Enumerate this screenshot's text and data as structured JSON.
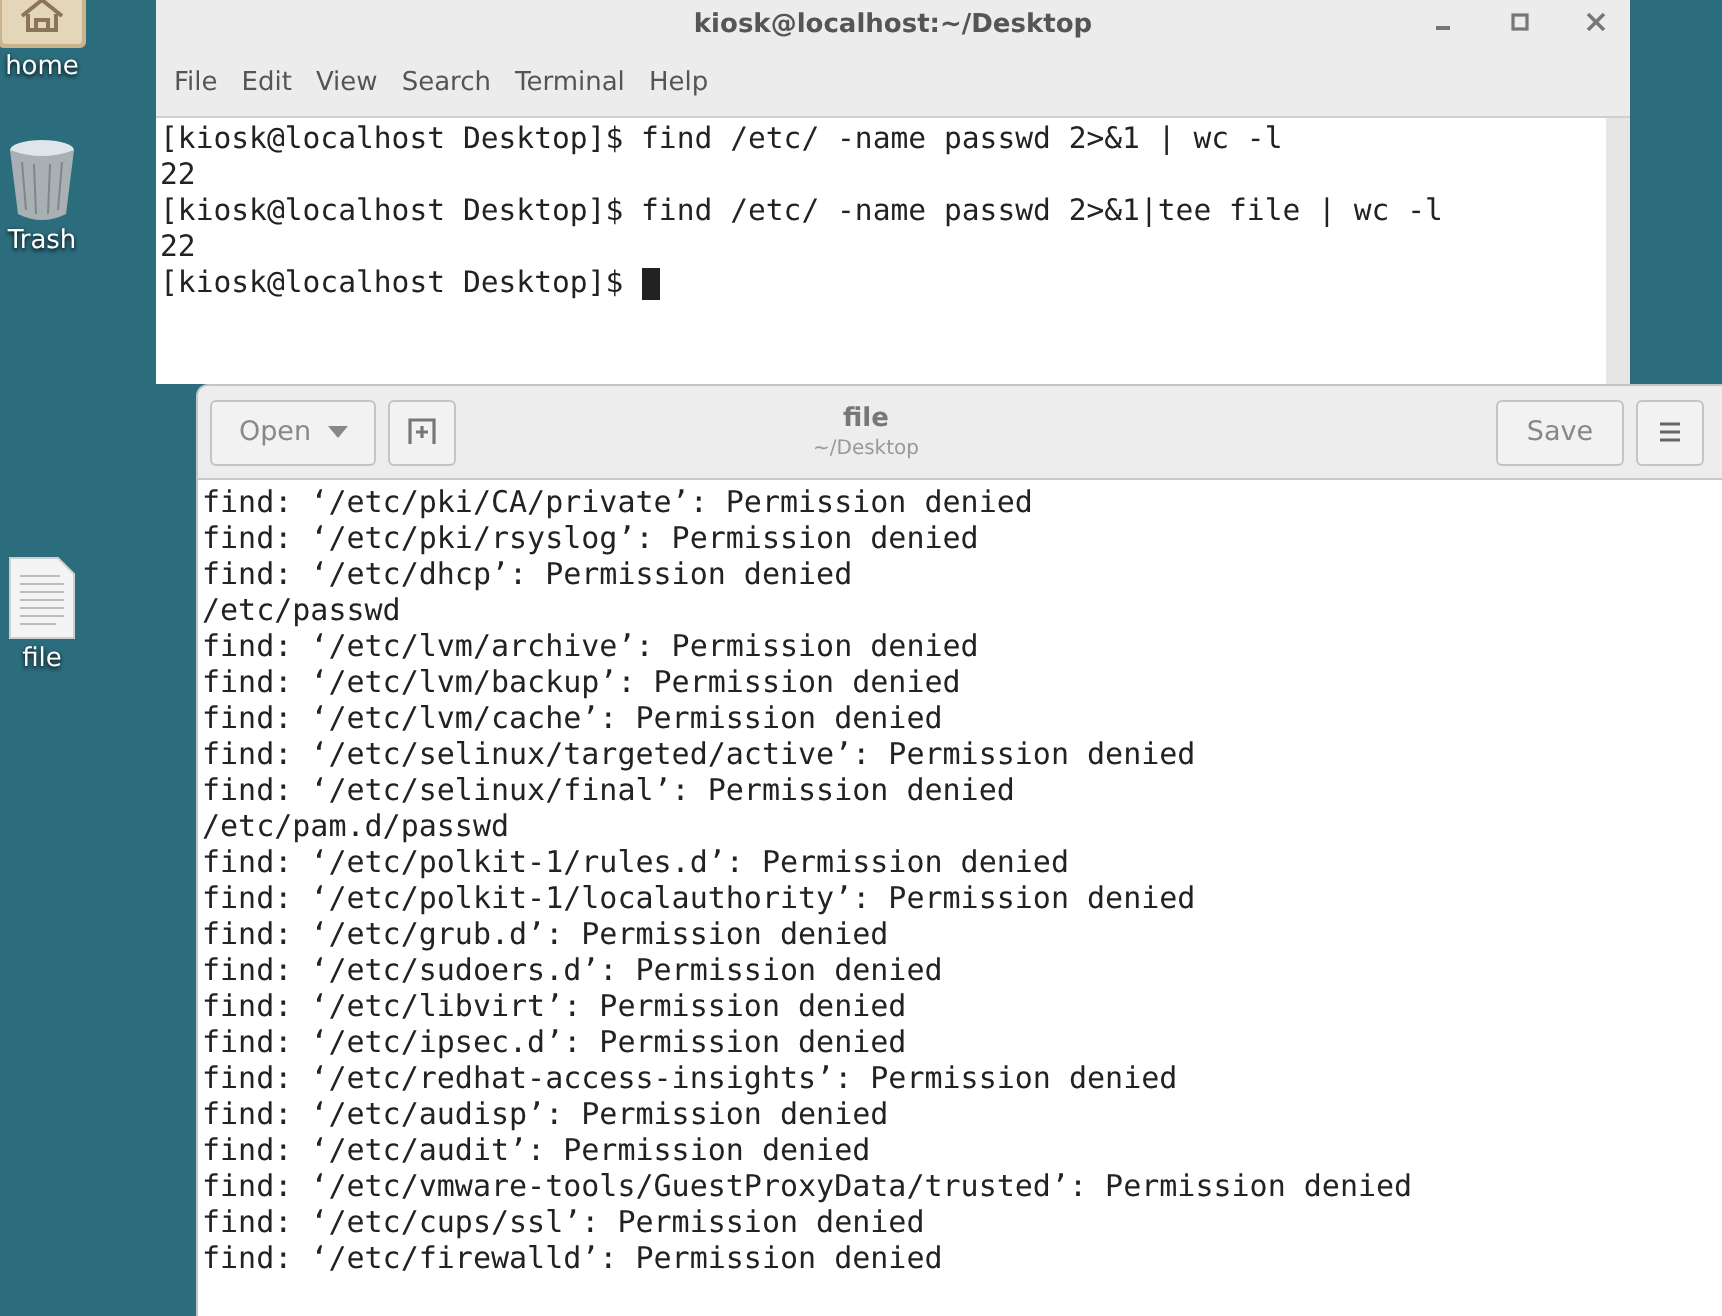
{
  "desktop_icons": [
    {
      "kind": "folder",
      "label": "home"
    },
    {
      "kind": "trash",
      "label": "Trash"
    },
    {
      "kind": "document",
      "label": "file"
    }
  ],
  "terminal": {
    "title": "kiosk@localhost:~/Desktop",
    "menu": [
      "File",
      "Edit",
      "View",
      "Search",
      "Terminal",
      "Help"
    ],
    "lines": [
      "[kiosk@localhost Desktop]$ find /etc/ -name passwd 2>&1 | wc -l",
      "22",
      "[kiosk@localhost Desktop]$ find /etc/ -name passwd 2>&1|tee file | wc -l",
      "22",
      "[kiosk@localhost Desktop]$ "
    ],
    "cursor": true
  },
  "editor": {
    "open_button": "Open",
    "title": "file",
    "subtitle": "~/Desktop",
    "save_button": "Save",
    "lines": [
      "find: ‘/etc/pki/CA/private’: Permission denied",
      "find: ‘/etc/pki/rsyslog’: Permission denied",
      "find: ‘/etc/dhcp’: Permission denied",
      "/etc/passwd",
      "find: ‘/etc/lvm/archive’: Permission denied",
      "find: ‘/etc/lvm/backup’: Permission denied",
      "find: ‘/etc/lvm/cache’: Permission denied",
      "find: ‘/etc/selinux/targeted/active’: Permission denied",
      "find: ‘/etc/selinux/final’: Permission denied",
      "/etc/pam.d/passwd",
      "find: ‘/etc/polkit-1/rules.d’: Permission denied",
      "find: ‘/etc/polkit-1/localauthority’: Permission denied",
      "find: ‘/etc/grub.d’: Permission denied",
      "find: ‘/etc/sudoers.d’: Permission denied",
      "find: ‘/etc/libvirt’: Permission denied",
      "find: ‘/etc/ipsec.d’: Permission denied",
      "find: ‘/etc/redhat-access-insights’: Permission denied",
      "find: ‘/etc/audisp’: Permission denied",
      "find: ‘/etc/audit’: Permission denied",
      "find: ‘/etc/vmware-tools/GuestProxyData/trusted’: Permission denied",
      "find: ‘/etc/cups/ssl’: Permission denied",
      "find: ‘/etc/firewalld’: Permission denied"
    ]
  }
}
